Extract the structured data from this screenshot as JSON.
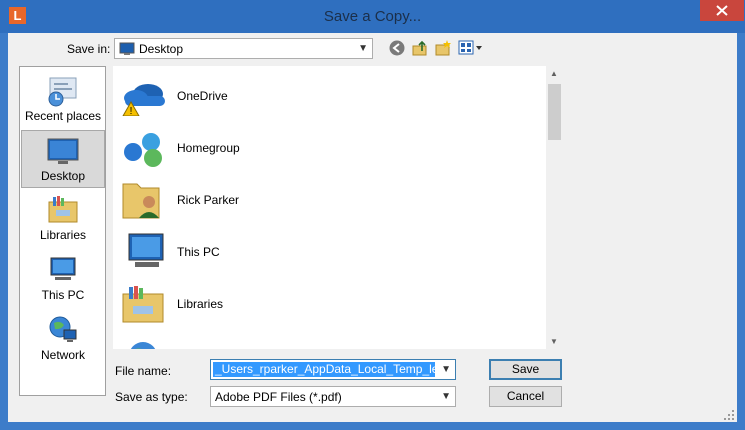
{
  "window": {
    "title": "Save a Copy...",
    "app_icon_letter": "L",
    "colors": {
      "titlebar": "#2f6fbf",
      "close": "#c9463d",
      "selection": "#3399ff"
    }
  },
  "toolbar": {
    "save_in_label": "Save in:",
    "save_in_value": "Desktop",
    "icons": [
      "back-icon",
      "up-folder-icon",
      "new-folder-icon",
      "view-menu-icon"
    ]
  },
  "places": [
    {
      "label": "Recent places",
      "icon": "recent-places-icon"
    },
    {
      "label": "Desktop",
      "icon": "desktop-icon",
      "selected": true
    },
    {
      "label": "Libraries",
      "icon": "libraries-icon"
    },
    {
      "label": "This PC",
      "icon": "this-pc-icon"
    },
    {
      "label": "Network",
      "icon": "network-icon"
    }
  ],
  "files": [
    {
      "name": "OneDrive",
      "icon": "onedrive-icon"
    },
    {
      "name": "Homegroup",
      "icon": "homegroup-icon"
    },
    {
      "name": "Rick Parker",
      "icon": "user-folder-icon"
    },
    {
      "name": "This PC",
      "icon": "this-pc-icon"
    },
    {
      "name": "Libraries",
      "icon": "libraries-icon"
    }
  ],
  "form": {
    "file_name_label": "File name:",
    "file_name_value": "_Users_rparker_AppData_Local_Temp_ledAFA",
    "save_as_type_label": "Save as type:",
    "save_as_type_value": "Adobe PDF Files (*.pdf)"
  },
  "buttons": {
    "save": "Save",
    "cancel": "Cancel"
  }
}
